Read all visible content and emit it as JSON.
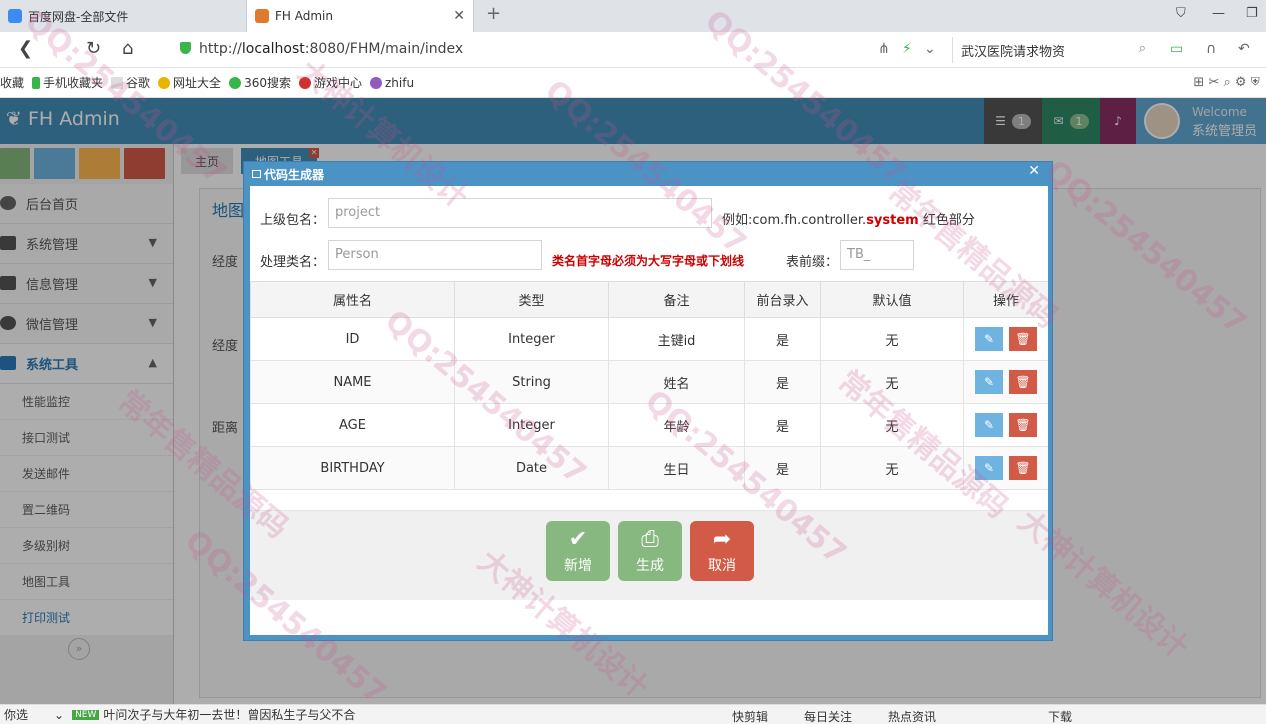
{
  "browser": {
    "tabs": [
      {
        "title": "百度网盘-全部文件"
      },
      {
        "title": "FH Admin"
      }
    ],
    "url_prefix": "http://",
    "url_host": "localhost",
    "url_path": ":8080/FHM/main/index",
    "search_text": "武汉医院请求物资",
    "bookmarks": [
      "收藏",
      "手机收藏夹",
      "谷歌",
      "网址大全",
      "360搜索",
      "游戏中心",
      "zhifu"
    ]
  },
  "app": {
    "brand": "FH Admin",
    "tasks_badge": "1",
    "messages_badge": "1",
    "welcome": "Welcome",
    "username": "系统管理员"
  },
  "sidebar": {
    "items": [
      {
        "label": "后台首页"
      },
      {
        "label": "系统管理"
      },
      {
        "label": "信息管理"
      },
      {
        "label": "微信管理"
      },
      {
        "label": "系统工具"
      }
    ],
    "subitems": [
      {
        "label": "性能监控"
      },
      {
        "label": "接口测试"
      },
      {
        "label": "发送邮件"
      },
      {
        "label": "置二维码"
      },
      {
        "label": "多级别树"
      },
      {
        "label": "地图工具"
      },
      {
        "label": "打印测试"
      }
    ]
  },
  "content_tabs": [
    {
      "label": "主页"
    },
    {
      "label": "地图工具"
    }
  ],
  "background_page": {
    "heading": "地图",
    "label_longitude1": "经度",
    "label_longitude2": "经度",
    "label_distance": "距离"
  },
  "dialog": {
    "title": "代码生成器",
    "package_label": "上级包名：",
    "package_placeholder": "project",
    "package_hint_prefix": "例如:com.fh.controller.",
    "package_hint_red": "system",
    "package_hint_suffix": "红色部分",
    "class_label": "处理类名：",
    "class_placeholder": "Person",
    "class_warning": "类名首字母必须为大写字母或下划线",
    "prefix_label": "表前缀：",
    "prefix_placeholder": "TB_",
    "columns": [
      "属性名",
      "类型",
      "备注",
      "前台录入",
      "默认值",
      "操作"
    ],
    "rows": [
      {
        "name": "ID",
        "type": "Integer",
        "remark": "主键id",
        "input": "是",
        "default": "无"
      },
      {
        "name": "NAME",
        "type": "String",
        "remark": "姓名",
        "input": "是",
        "default": "无"
      },
      {
        "name": "AGE",
        "type": "Integer",
        "remark": "年龄",
        "input": "是",
        "default": "无"
      },
      {
        "name": "BIRTHDAY",
        "type": "Date",
        "remark": "生日",
        "input": "是",
        "default": "无"
      }
    ],
    "btn_add": "新增",
    "btn_generate": "生成",
    "btn_cancel": "取消"
  },
  "statusbar": {
    "left": "你选",
    "news": "叶问次子与大年初一去世！曾因私生子与父不合",
    "items": [
      "快剪辑",
      "每日关注",
      "热点资讯",
      "下载"
    ]
  },
  "watermarks": [
    "QQ:254540457",
    "大神计算机设计",
    "常年售精品源码"
  ]
}
